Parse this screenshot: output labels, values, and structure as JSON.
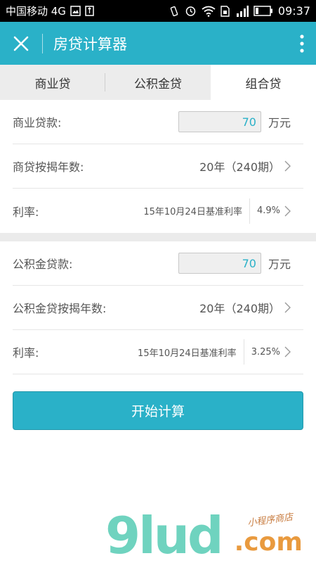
{
  "status": {
    "carrier": "中国移动 4G",
    "time": "09:37"
  },
  "appbar": {
    "title": "房贷计算器"
  },
  "tabs": [
    {
      "label": "商业贷",
      "active": false
    },
    {
      "label": "公积金贷",
      "active": false
    },
    {
      "label": "组合贷",
      "active": true
    }
  ],
  "commercial": {
    "amount_label": "商业贷款:",
    "amount_value": "70",
    "amount_unit": "万元",
    "years_label": "商贷按揭年数:",
    "years_value": "20年（240期）",
    "rate_label": "利率:",
    "rate_note": "15年10月24日基准利率",
    "rate_value": "4.9%"
  },
  "fund": {
    "amount_label": "公积金贷款:",
    "amount_value": "70",
    "amount_unit": "万元",
    "years_label": "公积金贷按揭年数:",
    "years_value": "20年（240期）",
    "rate_label": "利率:",
    "rate_note": "15年10月24日基准利率",
    "rate_value": "3.25%"
  },
  "actions": {
    "start_label": "开始计算"
  },
  "watermark": {
    "main": "9lud",
    "sub": "小程序商店",
    "com": ".com"
  },
  "colors": {
    "accent": "#2ab1c8",
    "watermark_green": "#6fd3bf",
    "watermark_orange": "#e99a3e"
  }
}
